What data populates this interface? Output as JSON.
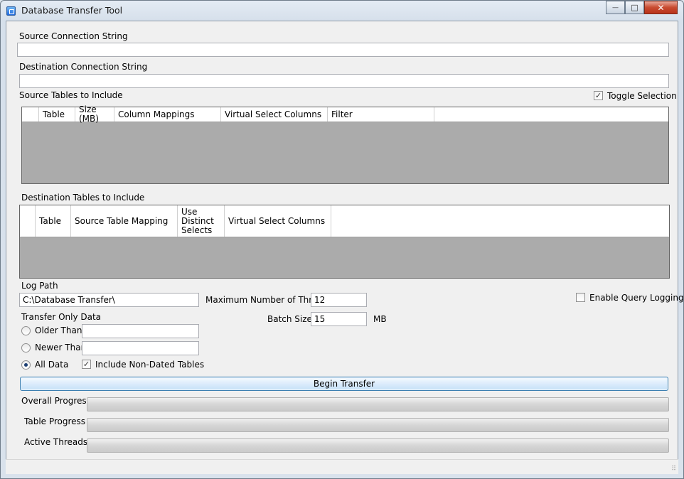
{
  "window": {
    "title": "Database Transfer Tool",
    "minimize_glyph": "—",
    "maximize_glyph": "□",
    "close_glyph": "✕"
  },
  "source_connection": {
    "label": "Source Connection String",
    "value": ""
  },
  "destination_connection": {
    "label": "Destination Connection String",
    "value": ""
  },
  "source_tables": {
    "label": "Source Tables to Include",
    "toggle_label": "Toggle Selection",
    "toggle_checked": true,
    "columns": [
      "",
      "Table",
      "Size (MB)",
      "Column Mappings",
      "Virtual Select Columns",
      "Filter"
    ],
    "rows": []
  },
  "destination_tables": {
    "label": "Destination Tables to Include",
    "columns": [
      "",
      "Table",
      "Source Table Mapping",
      "Use Distinct Selects",
      "Virtual Select Columns"
    ],
    "rows": []
  },
  "log_path": {
    "label": "Log Path",
    "value": "C:\\Database Transfer\\"
  },
  "max_threads": {
    "label": "Maximum Number of Threads",
    "value": "12"
  },
  "batch_size": {
    "label": "Batch Size",
    "value": "15",
    "unit": "MB"
  },
  "query_logging": {
    "label": "Enable Query Logging",
    "checked": false
  },
  "transfer_only": {
    "label": "Transfer Only Data",
    "options": [
      {
        "label": "Older Than",
        "checked": false,
        "value": ""
      },
      {
        "label": "Newer Than",
        "checked": false,
        "value": ""
      },
      {
        "label": "All Data",
        "checked": true
      }
    ],
    "include_non_dated": {
      "label": "Include Non-Dated Tables",
      "checked": true
    }
  },
  "begin_button": "Begin Transfer",
  "progress": {
    "overall": {
      "label": "Overall Progress",
      "fraction": 0
    },
    "table": {
      "label": "Table Progress",
      "fraction": 0
    },
    "threads": {
      "label": "Active Threads",
      "fraction": 0
    }
  },
  "colors": {
    "grid_background": "#ababab",
    "button_border": "#3c7fb1",
    "window_frame": "#d9e2ec"
  }
}
